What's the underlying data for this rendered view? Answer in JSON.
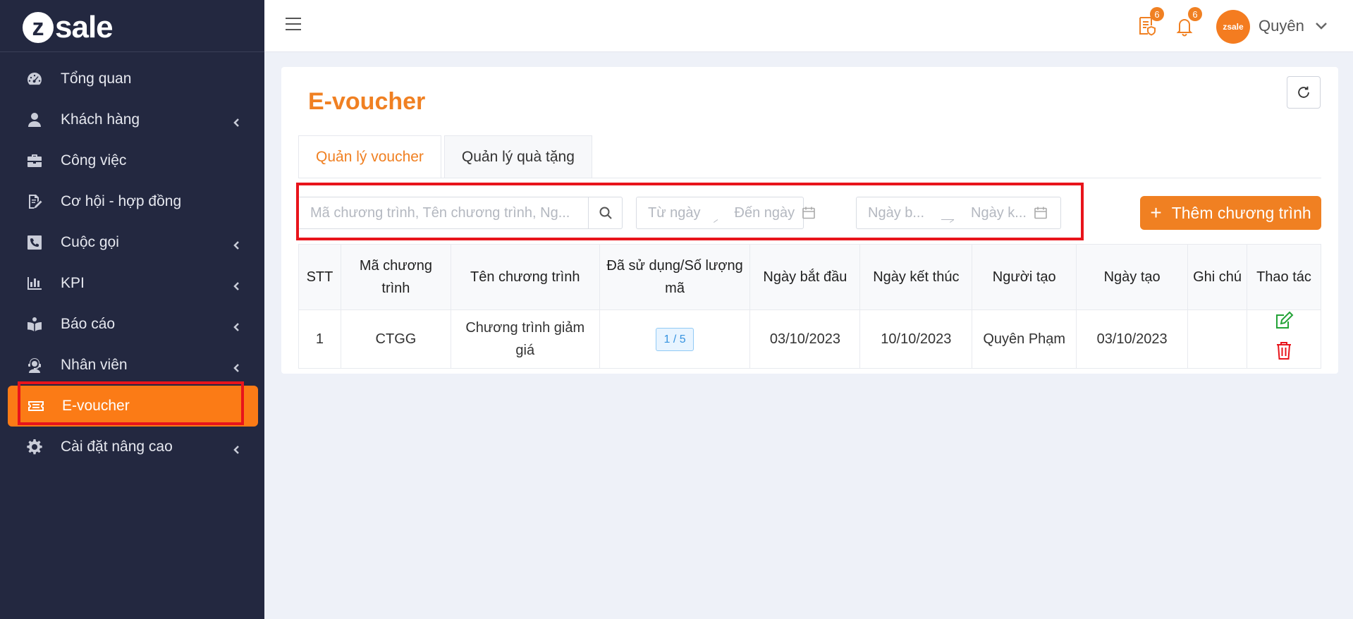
{
  "brand": {
    "logo_mark": "z",
    "logo_text": "sale"
  },
  "sidebar": {
    "items": [
      {
        "label": "Tổng quan",
        "icon": "dashboard-icon",
        "has_submenu": false
      },
      {
        "label": "Khách hàng",
        "icon": "user-icon",
        "has_submenu": true
      },
      {
        "label": "Công việc",
        "icon": "briefcase-icon",
        "has_submenu": false
      },
      {
        "label": "Cơ hội - hợp đồng",
        "icon": "contract-icon",
        "has_submenu": false
      },
      {
        "label": "Cuộc gọi",
        "icon": "phone-icon",
        "has_submenu": true
      },
      {
        "label": "KPI",
        "icon": "bar-chart-icon",
        "has_submenu": true
      },
      {
        "label": "Báo cáo",
        "icon": "report-icon",
        "has_submenu": true
      },
      {
        "label": "Nhân viên",
        "icon": "staff-icon",
        "has_submenu": true
      },
      {
        "label": "E-voucher",
        "icon": "ticket-icon",
        "has_submenu": false,
        "active": true
      },
      {
        "label": "Cài đặt nâng cao",
        "icon": "cog-icon",
        "has_submenu": true
      }
    ]
  },
  "topbar": {
    "task_badge": "6",
    "notification_badge": "6",
    "avatar_text": "zsale",
    "user_name": "Quyên"
  },
  "page": {
    "title": "E-voucher",
    "tabs": [
      {
        "label": "Quản lý voucher",
        "active": true
      },
      {
        "label": "Quản lý quà tặng",
        "active": false
      }
    ],
    "filters": {
      "search_placeholder": "Mã chương trình, Tên chương trình, Ng...",
      "date_from_placeholder": "Từ ngày",
      "date_to_placeholder": "Đến ngày",
      "start_date_placeholder": "Ngày b...",
      "end_date_placeholder": "Ngày k..."
    },
    "add_button": "Thêm chương trình"
  },
  "table": {
    "headers": [
      "STT",
      "Mã chương trình",
      "Tên chương trình",
      "Đã sử dụng/Số lượng mã",
      "Ngày bắt đầu",
      "Ngày kết thúc",
      "Người tạo",
      "Ngày tạo",
      "Ghi chú",
      "Thao tác"
    ],
    "rows": [
      {
        "stt": "1",
        "code": "CTGG",
        "name": "Chương trình giảm giá",
        "usage": "1 / 5",
        "start": "03/10/2023",
        "end": "10/10/2023",
        "creator": "Quyên Phạm",
        "created": "03/10/2023",
        "note": ""
      }
    ]
  },
  "colors": {
    "accent": "#f08022",
    "sidebar_bg": "#232840",
    "active_item": "#fb7b16",
    "highlight_box": "#e8141b"
  }
}
